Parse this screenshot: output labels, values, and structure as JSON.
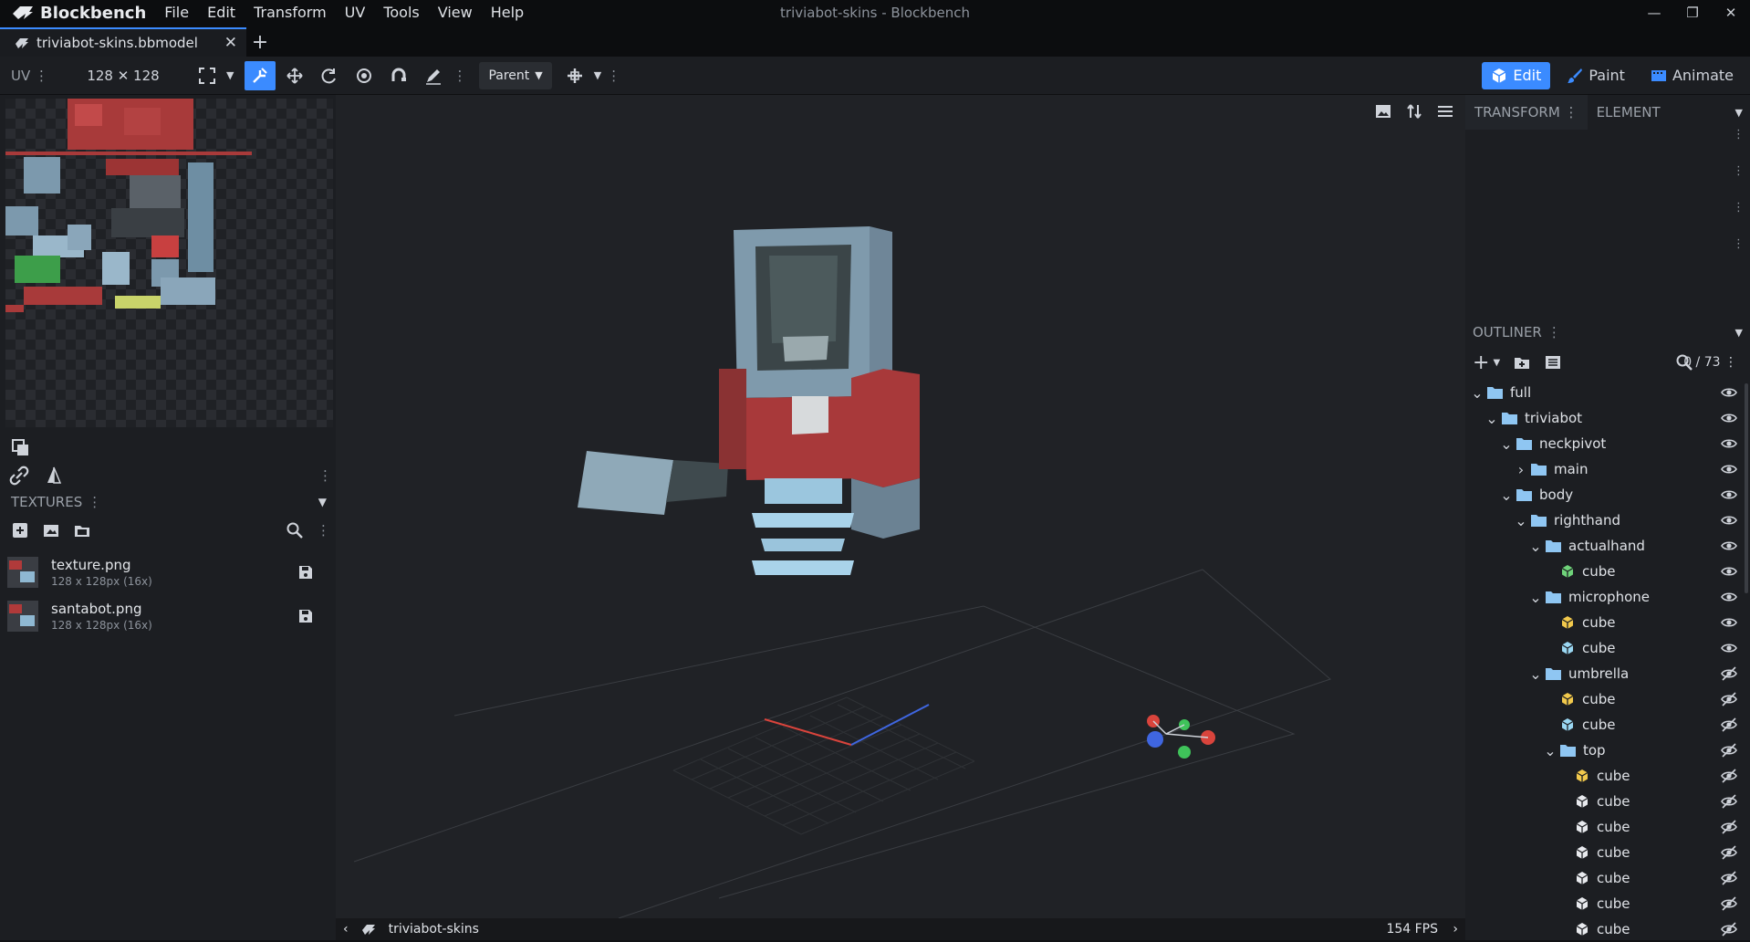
{
  "app": {
    "name": "Blockbench",
    "window_title": "triviabot-skins - Blockbench",
    "menu": [
      "File",
      "Edit",
      "Transform",
      "UV",
      "Tools",
      "View",
      "Help"
    ]
  },
  "tabs": [
    {
      "title": "triviabot-skins.bbmodel"
    }
  ],
  "toolbar": {
    "uv_label": "UV",
    "uv_size": "128 ✕ 128",
    "parent_select": "Parent",
    "modes": [
      {
        "label": "Edit",
        "icon": "cube-icon",
        "active": true
      },
      {
        "label": "Paint",
        "icon": "brush-icon",
        "active": false
      },
      {
        "label": "Animate",
        "icon": "film-icon",
        "active": false
      }
    ]
  },
  "textures": {
    "header": "TEXTURES",
    "items": [
      {
        "name": "texture.png",
        "meta": "128 x 128px (16x)"
      },
      {
        "name": "santabot.png",
        "meta": "128 x 128px (16x)"
      }
    ]
  },
  "right_panel": {
    "tabs": [
      "TRANSFORM",
      "ELEMENT"
    ],
    "outliner_header": "OUTLINER",
    "count": "0 / 73",
    "tree": [
      {
        "label": "full",
        "depth": 0,
        "type": "folder",
        "expanded": true,
        "visible": true
      },
      {
        "label": "triviabot",
        "depth": 1,
        "type": "folder",
        "expanded": true,
        "visible": true
      },
      {
        "label": "neckpivot",
        "depth": 2,
        "type": "folder",
        "expanded": true,
        "visible": true
      },
      {
        "label": "main",
        "depth": 3,
        "type": "folder",
        "expanded": false,
        "visible": true
      },
      {
        "label": "body",
        "depth": 2,
        "type": "folder",
        "expanded": true,
        "visible": true
      },
      {
        "label": "righthand",
        "depth": 3,
        "type": "folder",
        "expanded": true,
        "visible": true
      },
      {
        "label": "actualhand",
        "depth": 4,
        "type": "folder",
        "expanded": true,
        "visible": true
      },
      {
        "label": "cube",
        "depth": 5,
        "type": "cube",
        "color": "#6fd37a",
        "visible": true
      },
      {
        "label": "microphone",
        "depth": 4,
        "type": "folder",
        "expanded": true,
        "visible": true
      },
      {
        "label": "cube",
        "depth": 5,
        "type": "cube",
        "color": "#f2c94c",
        "visible": true
      },
      {
        "label": "cube",
        "depth": 5,
        "type": "cube",
        "color": "#9ad7f2",
        "visible": true
      },
      {
        "label": "umbrella",
        "depth": 4,
        "type": "folder",
        "expanded": true,
        "visible": false
      },
      {
        "label": "cube",
        "depth": 5,
        "type": "cube",
        "color": "#f2c94c",
        "visible": false
      },
      {
        "label": "cube",
        "depth": 5,
        "type": "cube",
        "color": "#9ad7f2",
        "visible": false
      },
      {
        "label": "top",
        "depth": 5,
        "type": "folder",
        "expanded": true,
        "visible": false
      },
      {
        "label": "cube",
        "depth": 6,
        "type": "cube",
        "color": "#f2c94c",
        "visible": false
      },
      {
        "label": "cube",
        "depth": 6,
        "type": "cube",
        "color": "#e8eaee",
        "visible": false
      },
      {
        "label": "cube",
        "depth": 6,
        "type": "cube",
        "color": "#e8eaee",
        "visible": false
      },
      {
        "label": "cube",
        "depth": 6,
        "type": "cube",
        "color": "#e8eaee",
        "visible": false
      },
      {
        "label": "cube",
        "depth": 6,
        "type": "cube",
        "color": "#e8eaee",
        "visible": false
      },
      {
        "label": "cube",
        "depth": 6,
        "type": "cube",
        "color": "#e8eaee",
        "visible": false
      },
      {
        "label": "cube",
        "depth": 6,
        "type": "cube",
        "color": "#e8eaee",
        "visible": false
      }
    ]
  },
  "status": {
    "project": "triviabot-skins",
    "fps": "154 FPS"
  },
  "colors": {
    "accent": "#3b8bff"
  }
}
